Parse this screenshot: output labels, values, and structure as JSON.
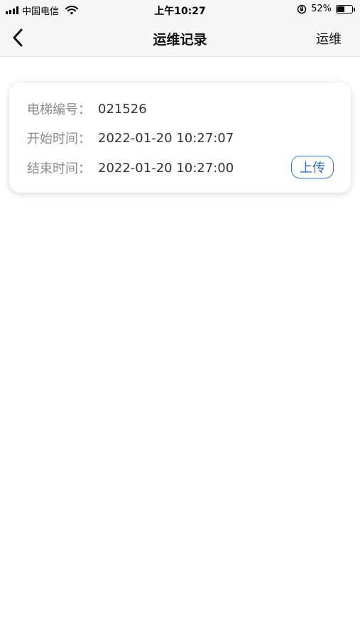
{
  "status_bar": {
    "carrier": "中国电信",
    "time": "上午10:27",
    "battery_percent": "52%",
    "battery_level": 0.52
  },
  "nav": {
    "back_icon": "chevron-left-icon",
    "title": "运维记录",
    "right_action": "运维"
  },
  "record": {
    "elevator_label": "电梯编号：",
    "elevator_value": "021526",
    "start_label": "开始时间：",
    "start_value": "2022-01-20 10:27:07",
    "end_label": "结束时间：",
    "end_value": "2022-01-20 10:27:00",
    "upload_label": "上传"
  },
  "colors": {
    "accent": "#3a7bd5",
    "label_gray": "#8a8a8a",
    "bar_bg": "#f7f7f7"
  }
}
